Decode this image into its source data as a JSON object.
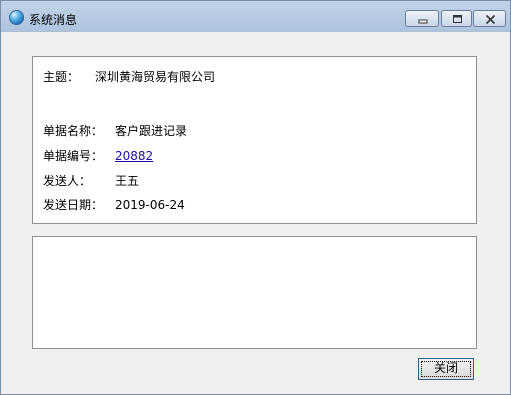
{
  "window": {
    "title": "系统消息",
    "title_icon": "globe-icon",
    "controls": {
      "minimize_icon": "minimize-icon",
      "maximize_icon": "maximize-icon",
      "close_icon": "close-icon"
    }
  },
  "info": {
    "subject_label": "主题：",
    "subject_value": "深圳黄海贸易有限公司",
    "doc_name_label": "单据名称：",
    "doc_name_value": "客户跟进记录",
    "doc_number_label": "单据编号：",
    "doc_number_value": "20882",
    "sender_label": "发送人：",
    "sender_value": "王五",
    "send_date_label": "发送日期：",
    "send_date_value": "2019-06-24"
  },
  "message": {
    "body": ""
  },
  "footer": {
    "close_label": "关闭"
  },
  "colors": {
    "titlebar": "#b9cce3",
    "link": "#1a0dab",
    "button_border": "#2c5f93"
  }
}
